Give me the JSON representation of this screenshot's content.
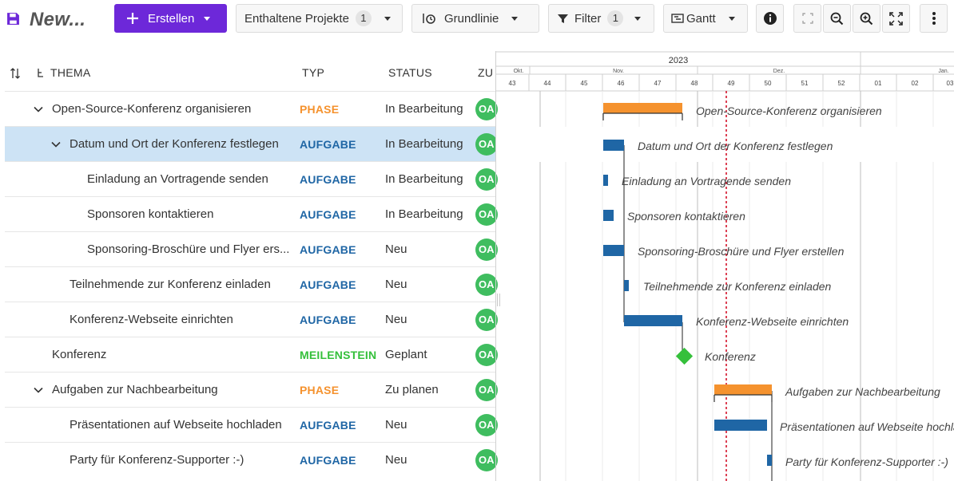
{
  "toolbar": {
    "title": "New...",
    "create_label": "Erstellen",
    "included_projects_label": "Enthaltene Projekte",
    "included_projects_count": "1",
    "baseline_label": "Grundlinie",
    "filter_label": "Filter",
    "filter_count": "1",
    "gantt_label": "Gantt",
    "icons": [
      "save-icon",
      "plus-icon",
      "baseline-icon",
      "filter-icon",
      "gantt-icon",
      "info-icon",
      "zoom-auto-icon",
      "zoom-out-icon",
      "zoom-in-icon",
      "fullscreen-icon",
      "more-icon"
    ]
  },
  "table": {
    "columns": {
      "subject": "THEMA",
      "type": "TYP",
      "status": "STATUS",
      "assignee": "ZU"
    },
    "rows": [
      {
        "subject": "Open-Source-Konferenz organisieren",
        "type": "PHASE",
        "status": "In Bearbeitung",
        "assignee": "OA"
      },
      {
        "subject": "Datum und Ort der Konferenz festlegen",
        "type": "AUFGABE",
        "status": "In Bearbeitung",
        "assignee": "OA"
      },
      {
        "subject": "Einladung an Vortragende senden",
        "type": "AUFGABE",
        "status": "In Bearbeitung",
        "assignee": "OA"
      },
      {
        "subject": "Sponsoren kontaktieren",
        "type": "AUFGABE",
        "status": "In Bearbeitung",
        "assignee": "OA"
      },
      {
        "subject": "Sponsoring-Broschüre und Flyer ers...",
        "type": "AUFGABE",
        "status": "Neu",
        "assignee": "OA"
      },
      {
        "subject": "Teilnehmende zur Konferenz einladen",
        "type": "AUFGABE",
        "status": "Neu",
        "assignee": "OA"
      },
      {
        "subject": "Konferenz-Webseite einrichten",
        "type": "AUFGABE",
        "status": "Neu",
        "assignee": "OA"
      },
      {
        "subject": "Konferenz",
        "type": "MEILENSTEIN",
        "status": "Geplant",
        "assignee": "OA"
      },
      {
        "subject": "Aufgaben zur Nachbearbeitung",
        "type": "PHASE",
        "status": "Zu planen",
        "assignee": "OA"
      },
      {
        "subject": "Präsentationen auf Webseite hochladen",
        "type": "AUFGABE",
        "status": "Neu",
        "assignee": "OA"
      },
      {
        "subject": "Party für Konferenz-Supporter :-)",
        "type": "AUFGABE",
        "status": "Neu",
        "assignee": "OA"
      }
    ]
  },
  "gantt": {
    "year": "2023",
    "months": [
      "Okt.",
      "Nov.",
      "Dez.",
      "Jan."
    ],
    "weeks": [
      "43",
      "44",
      "45",
      "46",
      "47",
      "48",
      "49",
      "50",
      "51",
      "52",
      "01",
      "02",
      "03"
    ],
    "labels": [
      "Open-Source-Konferenz organisieren",
      "Datum und Ort der Konferenz festlegen",
      "Einladung an Vortragende senden",
      "Sponsoren kontaktieren",
      "Sponsoring-Broschüre und Flyer erstellen",
      "Teilnehmende zur Konferenz einladen",
      "Konferenz-Webseite einrichten",
      "Konferenz",
      "Aufgaben zur Nachbearbeitung",
      "Präsentationen auf Webseite hochladen",
      "Party für Konferenz-Supporter :-)"
    ]
  },
  "colors": {
    "primary": "#6d28d9",
    "phase": "#f5922e",
    "task": "#1f66a5",
    "milestone": "#35c03b",
    "avatar": "#3fbd5f",
    "selected_row": "#cde3f5",
    "today_line": "#d0021b"
  }
}
